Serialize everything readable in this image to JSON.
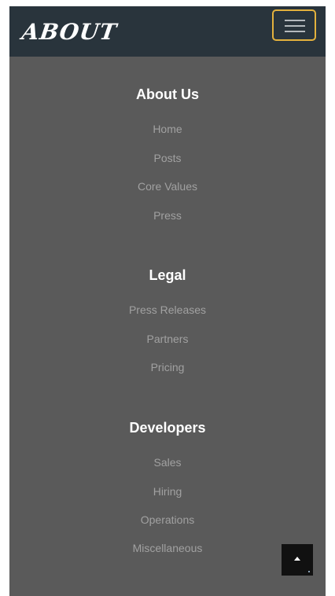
{
  "header": {
    "brand": "ABOUT",
    "menu_icon": "hamburger-menu-icon",
    "toggler_border_color": "#e3b13d",
    "background_color": "#29343c"
  },
  "footer": {
    "background_color": "#5a5a5a",
    "sections": [
      {
        "title": "About Us",
        "links": [
          "Home",
          "Posts",
          "Core Values",
          "Press"
        ]
      },
      {
        "title": "Legal",
        "links": [
          "Press Releases",
          "Partners",
          "Pricing"
        ]
      },
      {
        "title": "Developers",
        "links": [
          "Sales",
          "Hiring",
          "Operations",
          "Miscellaneous"
        ]
      }
    ]
  },
  "back_to_top": {
    "icon": "chevron-up-icon"
  }
}
